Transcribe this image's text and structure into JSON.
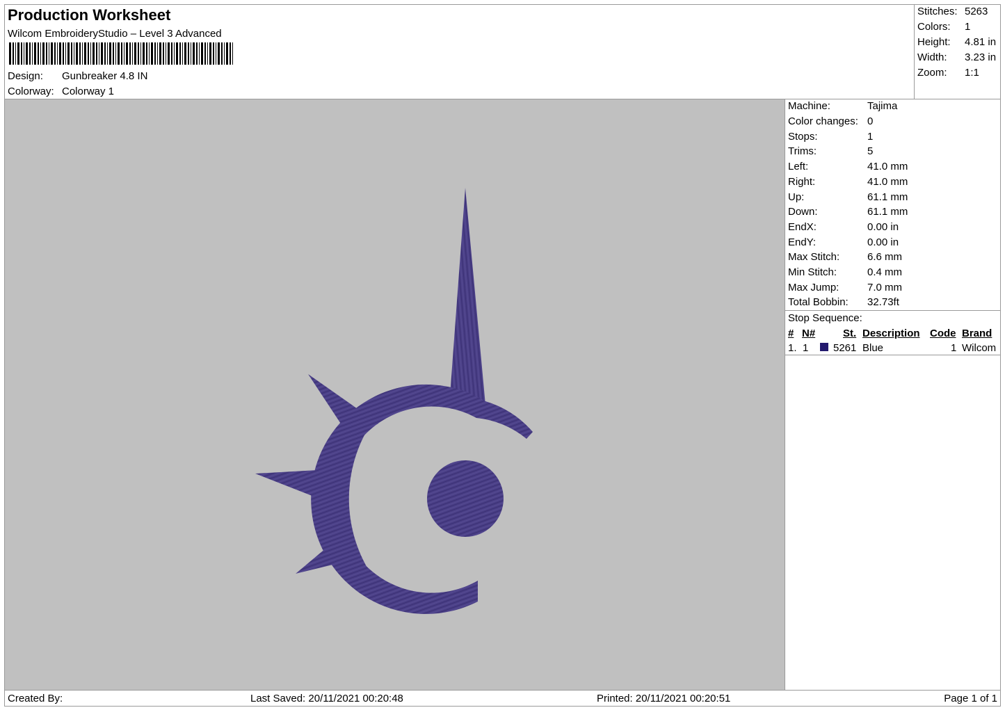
{
  "header": {
    "title": "Production Worksheet",
    "subtitle": "Wilcom EmbroideryStudio – Level 3 Advanced",
    "design_label": "Design:",
    "design_value": "Gunbreaker 4.8 IN",
    "colorway_label": "Colorway:",
    "colorway_value": "Colorway 1"
  },
  "summary": [
    {
      "label": "Stitches:",
      "value": "5263"
    },
    {
      "label": "Colors:",
      "value": "1"
    },
    {
      "label": "Height:",
      "value": "4.81 in"
    },
    {
      "label": "Width:",
      "value": "3.23 in"
    },
    {
      "label": "Zoom:",
      "value": "1:1"
    }
  ],
  "machine": [
    {
      "label": "Machine:",
      "value": "Tajima"
    },
    {
      "label": "Color changes:",
      "value": "0"
    },
    {
      "label": "Stops:",
      "value": "1"
    },
    {
      "label": "Trims:",
      "value": "5"
    },
    {
      "label": "Left:",
      "value": "41.0 mm"
    },
    {
      "label": "Right:",
      "value": "41.0 mm"
    },
    {
      "label": "Up:",
      "value": "61.1 mm"
    },
    {
      "label": "Down:",
      "value": "61.1 mm"
    },
    {
      "label": "EndX:",
      "value": "0.00 in"
    },
    {
      "label": "EndY:",
      "value": "0.00 in"
    },
    {
      "label": "Max Stitch:",
      "value": "6.6 mm"
    },
    {
      "label": "Min Stitch:",
      "value": "0.4 mm"
    },
    {
      "label": "Max Jump:",
      "value": "7.0 mm"
    },
    {
      "label": "Total Bobbin:",
      "value": "32.73ft"
    }
  ],
  "stop_sequence": {
    "heading": "Stop Sequence:",
    "columns": {
      "idx": "#",
      "n": "N#",
      "st": "St.",
      "desc": "Description",
      "code": "Code",
      "brand": "Brand"
    },
    "rows": [
      {
        "idx": "1.",
        "n": "1",
        "color": "#231a6e",
        "st": "5261",
        "desc": "Blue",
        "code": "1",
        "brand": "Wilcom"
      }
    ]
  },
  "footer": {
    "created_by": "Created By:",
    "last_saved": "Last Saved: 20/11/2021 00:20:48",
    "printed": "Printed: 20/11/2021 00:20:51",
    "page": "Page 1 of 1"
  },
  "design_preview": {
    "background": "#c0c0c0",
    "thread_color": "#4a3f86",
    "icon": "gunbreaker-job-icon"
  }
}
